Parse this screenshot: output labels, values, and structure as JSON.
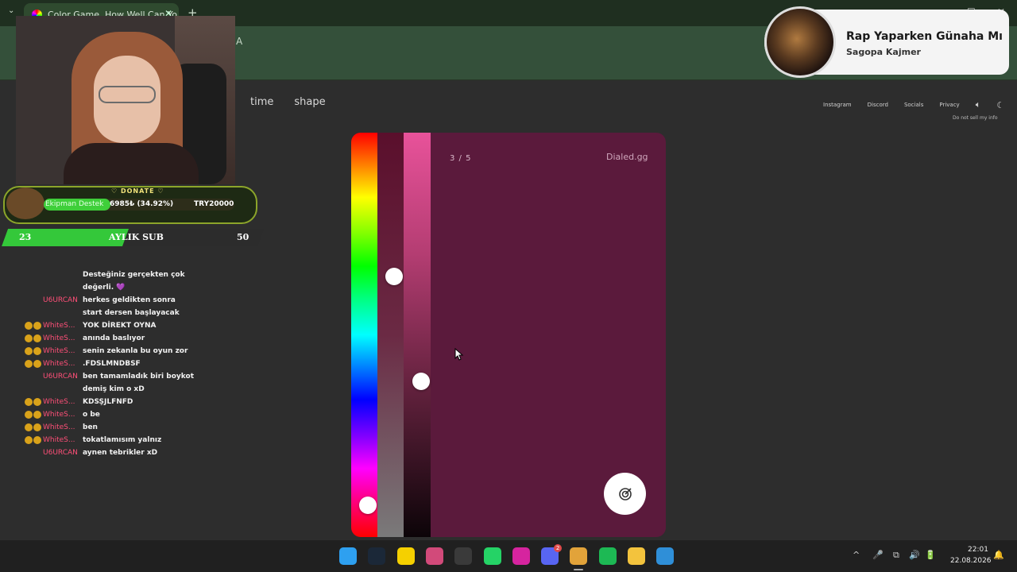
{
  "browser": {
    "tab_title": "Color Game. How Well Can Yo",
    "tab_close": "✕",
    "new_tab": "+",
    "tab_menu": "⌄",
    "address_partial": "A",
    "window_controls": [
      "–",
      "☐",
      "✕"
    ]
  },
  "page": {
    "nav_left": [
      "time",
      "shape"
    ],
    "nav_right": [
      "Instagram",
      "Discord",
      "Socials",
      "Privacy"
    ],
    "sound_icon": "sound-icon",
    "theme_icon": "moon-icon",
    "do_not_sell": "Do not sell my info"
  },
  "game": {
    "counter": "3 / 5",
    "brand": "Dialed.gg",
    "submit_icon": "target-icon",
    "background_color": "#5b1a3c",
    "hue_level": 0.94,
    "saturation_level": 0.35,
    "brightness_level": 0.62
  },
  "overlay": {
    "donate_title": "♡ DONATE ♡",
    "donate_label": "Ekipman Destek",
    "donate_amount": "6985₺ (34.92%)",
    "donate_goal": "TRY20000",
    "donate_progress": 0.3492,
    "sub_current": "23",
    "sub_label": "AYLIK SUB",
    "sub_goal": "50",
    "sub_progress": 0.46
  },
  "chat": [
    {
      "badges": 0,
      "user": "",
      "msg": "Desteğiniz gerçekten çok değerli. 💜"
    },
    {
      "badges": 0,
      "user": "U6URCAN",
      "msg": "herkes geldikten sonra start dersen başlayacak"
    },
    {
      "badges": 2,
      "user": "WhiteS...",
      "msg": "YOK DİREKT OYNA"
    },
    {
      "badges": 2,
      "user": "WhiteS...",
      "msg": "anında baslıyor"
    },
    {
      "badges": 2,
      "user": "WhiteS...",
      "msg": "senin zekanla bu oyun zor"
    },
    {
      "badges": 2,
      "user": "WhiteS...",
      "msg": ".FDSLMNDBSF"
    },
    {
      "badges": 0,
      "user": "U6URCAN",
      "msg": "ben tamamladık biri boykot demiş kim o xD"
    },
    {
      "badges": 2,
      "user": "WhiteS...",
      "msg": "KDSŞJLFNFD"
    },
    {
      "badges": 2,
      "user": "WhiteS...",
      "msg": "o be"
    },
    {
      "badges": 2,
      "user": "WhiteS...",
      "msg": "ben"
    },
    {
      "badges": 2,
      "user": "WhiteS...",
      "msg": "tokatlamısım yalnız"
    },
    {
      "badges": 0,
      "user": "U6URCAN",
      "msg": "aynen tebrikler xD"
    }
  ],
  "now_playing": {
    "title": "Rap Yaparken Günaha Mı",
    "artist": "Sagopa Kajmer"
  },
  "taskbar": {
    "apps": [
      {
        "name": "windows-start-icon",
        "color": "#2ea0f0"
      },
      {
        "name": "steam-icon",
        "color": "#1b2838"
      },
      {
        "name": "sticky-notes-icon",
        "color": "#f5d000"
      },
      {
        "name": "snipping-tool-icon",
        "color": "#d24a7a"
      },
      {
        "name": "obs-icon",
        "color": "#3a3a3a"
      },
      {
        "name": "whatsapp-icon",
        "color": "#25d366"
      },
      {
        "name": "instagram-icon",
        "color": "#d6249f"
      },
      {
        "name": "discord-icon",
        "color": "#5865f2"
      },
      {
        "name": "chrome-icon",
        "color": "#e2a33a"
      },
      {
        "name": "spotify-icon",
        "color": "#1db954"
      },
      {
        "name": "file-explorer-icon",
        "color": "#f3c33d"
      },
      {
        "name": "app-icon",
        "color": "#2f8fd8"
      }
    ],
    "discord_badge": "2",
    "tray_icons": [
      "^",
      "🎤",
      "⧉",
      "🔊",
      "🔋"
    ],
    "time": "22:01",
    "date": "22.08.2026",
    "notification_icon": "🔔"
  }
}
